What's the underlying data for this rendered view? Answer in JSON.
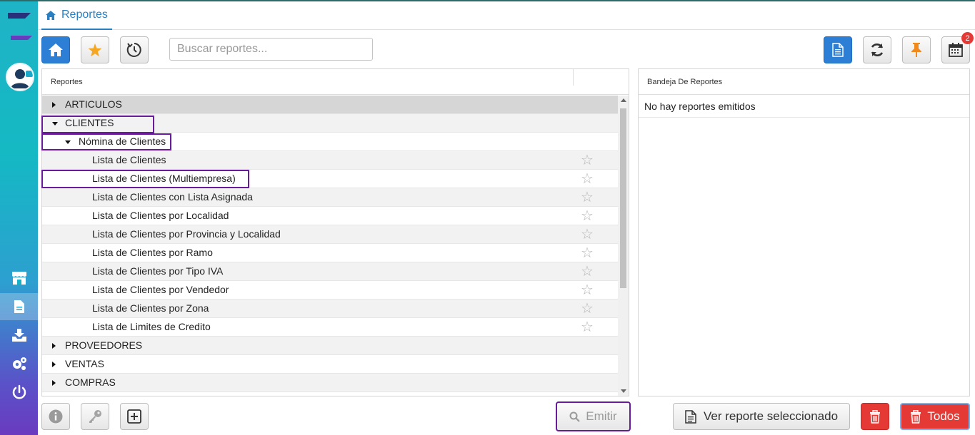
{
  "tab": {
    "label": "Reportes"
  },
  "search": {
    "placeholder": "Buscar reportes..."
  },
  "toolbar": {
    "calendar_badge": "2"
  },
  "left_panel": {
    "header": "Reportes"
  },
  "right_panel": {
    "header": "Bandeja De Reportes",
    "empty_text": "No hay reportes emitidos"
  },
  "tree": {
    "rows": [
      {
        "label": "ARTICULOS",
        "level": 0,
        "expanded": false,
        "star": false
      },
      {
        "label": "CLIENTES",
        "level": 0,
        "expanded": true,
        "star": false
      },
      {
        "label": "Nómina de Clientes",
        "level": 1,
        "expanded": true,
        "star": false
      },
      {
        "label": "Lista de Clientes",
        "level": 2,
        "star": true
      },
      {
        "label": "Lista de Clientes (Multiempresa)",
        "level": 2,
        "star": true
      },
      {
        "label": "Lista de Clientes con Lista Asignada",
        "level": 2,
        "star": true
      },
      {
        "label": "Lista de Clientes por Localidad",
        "level": 2,
        "star": true
      },
      {
        "label": "Lista de Clientes por Provincia y Localidad",
        "level": 2,
        "star": true
      },
      {
        "label": "Lista de Clientes por Ramo",
        "level": 2,
        "star": true
      },
      {
        "label": "Lista de Clientes por Tipo IVA",
        "level": 2,
        "star": true
      },
      {
        "label": "Lista de Clientes por Vendedor",
        "level": 2,
        "star": true
      },
      {
        "label": "Lista de Clientes por Zona",
        "level": 2,
        "star": true
      },
      {
        "label": "Lista de Limites de Credito",
        "level": 2,
        "star": true
      },
      {
        "label": "PROVEEDORES",
        "level": 0,
        "expanded": false,
        "star": false
      },
      {
        "label": "VENTAS",
        "level": 0,
        "expanded": false,
        "star": false
      },
      {
        "label": "COMPRAS",
        "level": 0,
        "expanded": false,
        "star": false
      }
    ]
  },
  "bottom": {
    "emitir_label": "Emitir",
    "ver_reporte_label": "Ver reporte seleccionado",
    "todos_label": "Todos"
  },
  "colors": {
    "accent": "#2d7fd6",
    "danger": "#e53935",
    "highlight": "#6a1b9a"
  }
}
